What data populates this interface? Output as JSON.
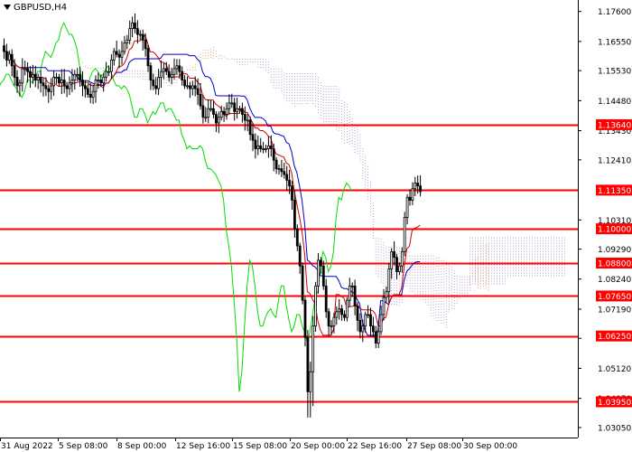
{
  "window": {
    "symbol_title": "GBPUSD,H4"
  },
  "colors": {
    "background": "#ffffff",
    "candles": "#000000",
    "level_lines": "#ff0000",
    "level_badge": "#ff0000",
    "chikou_span": "#00dd00",
    "kijun_sen": "#0000c8",
    "tenkan_sen": "#d00000",
    "cloud_dots_orange": "#e8a070",
    "cloud_dots_purple": "#b4a0d0"
  },
  "chart_data": {
    "type": "candlestick",
    "symbol": "GBPUSD",
    "timeframe": "H4",
    "x_tick_labels": [
      "31 Aug 2022",
      "5 Sep 08:00",
      "8 Sep 00:00",
      "12 Sep 16:00",
      "15 Sep 08:00",
      "20 Sep 00:00",
      "22 Sep 16:00",
      "27 Sep 08:00",
      "30 Sep 00:00"
    ],
    "y_tick_labels": [
      "1.17600",
      "1.16550",
      "1.15530",
      "1.14480",
      "1.13430",
      "1.12410",
      "1.10310",
      "1.09290",
      "1.08240",
      "1.07190",
      "1.06170",
      "1.05120",
      "1.04070",
      "1.03050"
    ],
    "ylim": [
      1.027,
      1.18
    ],
    "levels": [
      "1.13640",
      "1.11350",
      "1.10000",
      "1.08800",
      "1.07650",
      "1.06250",
      "1.03950"
    ],
    "level_values": [
      1.1364,
      1.1135,
      1.1,
      1.088,
      1.0765,
      1.0625,
      1.0395
    ],
    "current_price": 1.1135,
    "bars_shown": 180,
    "close": [
      1.162,
      1.159,
      1.161,
      1.157,
      1.153,
      1.15,
      1.151,
      1.156,
      1.156,
      1.155,
      1.153,
      1.154,
      1.152,
      1.153,
      1.151,
      1.15,
      1.149,
      1.148,
      1.15,
      1.153,
      1.153,
      1.151,
      1.152,
      1.15,
      1.149,
      1.151,
      1.152,
      1.154,
      1.154,
      1.152,
      1.15,
      1.149,
      1.147,
      1.146,
      1.148,
      1.152,
      1.152,
      1.151,
      1.153,
      1.155,
      1.155,
      1.159,
      1.162,
      1.161,
      1.16,
      1.162,
      1.165,
      1.166,
      1.17,
      1.172,
      1.17,
      1.168,
      1.168,
      1.166,
      1.163,
      1.157,
      1.152,
      1.15,
      1.149,
      1.153,
      1.155,
      1.156,
      1.155,
      1.153,
      1.154,
      1.156,
      1.157,
      1.155,
      1.152,
      1.15,
      1.15,
      1.149,
      1.15,
      1.149,
      1.147,
      1.143,
      1.139,
      1.139,
      1.142,
      1.142,
      1.14,
      1.137,
      1.139,
      1.141,
      1.14,
      1.142,
      1.144,
      1.144,
      1.141,
      1.142,
      1.142,
      1.14,
      1.138,
      1.138,
      1.133,
      1.131,
      1.128,
      1.129,
      1.128,
      1.128,
      1.128,
      1.129,
      1.128,
      1.124,
      1.121,
      1.121,
      1.12,
      1.119,
      1.117,
      1.115,
      1.11,
      1.1,
      1.094,
      1.087,
      1.075,
      1.062,
      1.043,
      1.05,
      1.066,
      1.08,
      1.089,
      1.087,
      1.08,
      1.071,
      1.066,
      1.066,
      1.069,
      1.071,
      1.072,
      1.07,
      1.069,
      1.075,
      1.08,
      1.08,
      1.073,
      1.068,
      1.064,
      1.066,
      1.07,
      1.07,
      1.066,
      1.064,
      1.06,
      1.064,
      1.07,
      1.076,
      1.078,
      1.086,
      1.092,
      1.09,
      1.085,
      1.087,
      1.092,
      1.104,
      1.111,
      1.11,
      1.114,
      1.116,
      1.115,
      1.113
    ]
  }
}
